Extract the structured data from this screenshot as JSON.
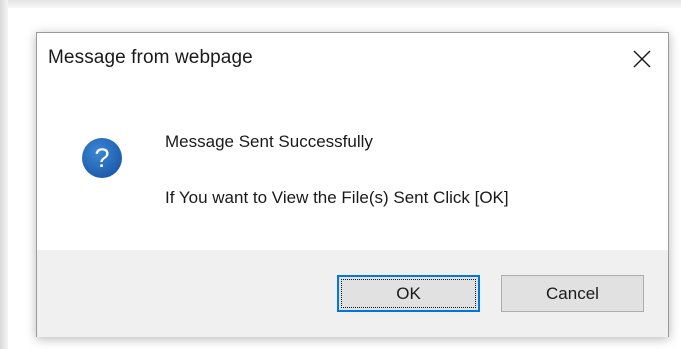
{
  "dialog": {
    "title": "Message from webpage",
    "icon": "question-icon",
    "message_lines": [
      "Message Sent Successfully",
      "If You want to View the File(s) Sent Click [OK]"
    ],
    "buttons": {
      "ok_label": "OK",
      "cancel_label": "Cancel"
    },
    "close_icon": "close-icon"
  },
  "colors": {
    "icon_blue": "#1e63b4",
    "focus_border": "#0078d7",
    "footer_bg": "#f0f0f0",
    "button_bg": "#e1e1e1"
  }
}
